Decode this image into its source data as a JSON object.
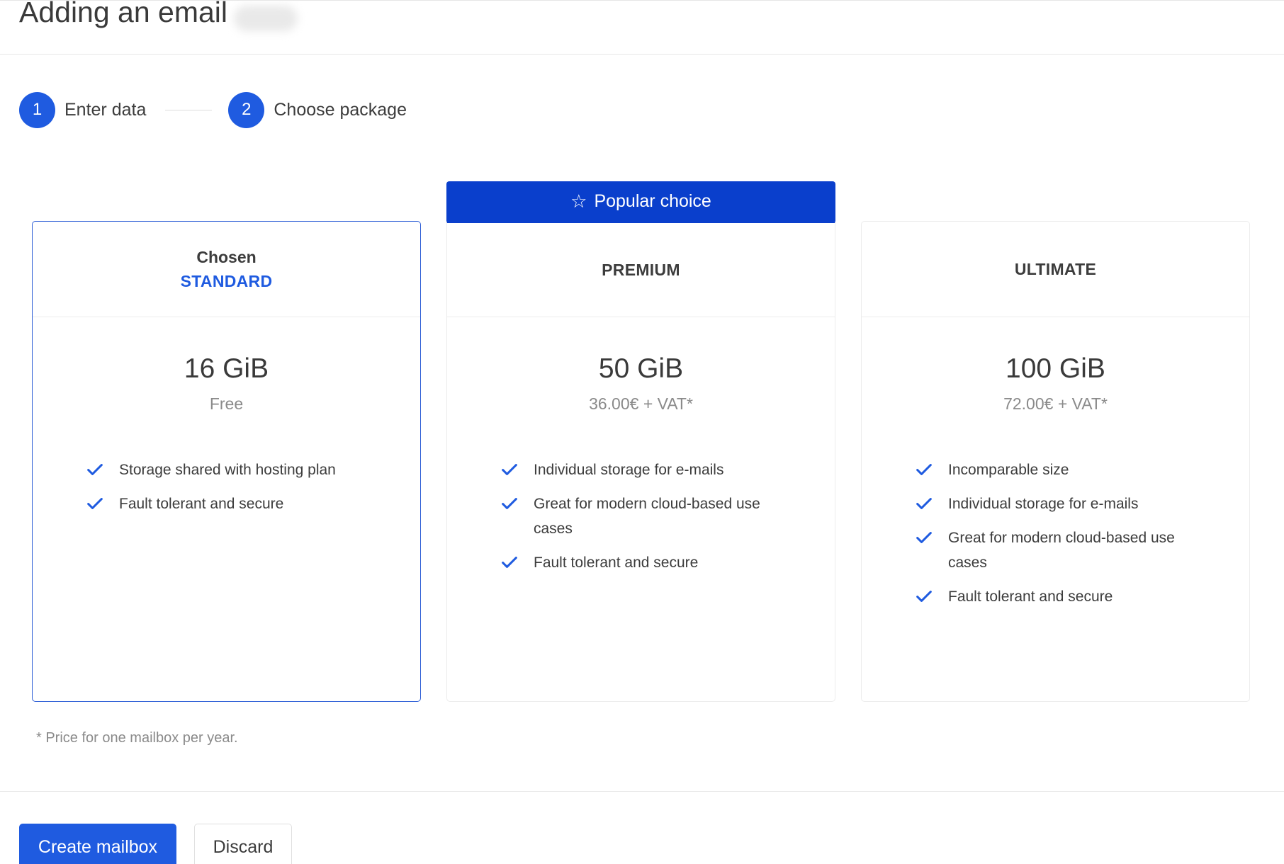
{
  "header": {
    "title": "Adding an email"
  },
  "stepper": {
    "steps": [
      {
        "number": "1",
        "label": "Enter data"
      },
      {
        "number": "2",
        "label": "Choose package"
      }
    ]
  },
  "banner": {
    "label": "Popular choice",
    "icon": "star-icon"
  },
  "plans": [
    {
      "chosen_label": "Chosen",
      "name": "STANDARD",
      "storage": "16 GiB",
      "price": "Free",
      "features": [
        "Storage shared with hosting plan",
        "Fault tolerant and secure"
      ]
    },
    {
      "name": "PREMIUM",
      "storage": "50 GiB",
      "price": "36.00€ + VAT*",
      "features": [
        "Individual storage for e-mails",
        "Great for modern cloud-based use cases",
        "Fault tolerant and secure"
      ]
    },
    {
      "name": "ULTIMATE",
      "storage": "100 GiB",
      "price": "72.00€ + VAT*",
      "features": [
        "Incomparable size",
        "Individual storage for e-mails",
        "Great for modern cloud-based use cases",
        "Fault tolerant and secure"
      ]
    }
  ],
  "footnote": "* Price for one mailbox per year.",
  "actions": {
    "create_label": "Create mailbox",
    "discard_label": "Discard"
  },
  "colors": {
    "accent": "#1f5be0",
    "banner": "#0a3fcc",
    "muted_text": "#8a8a8a"
  }
}
